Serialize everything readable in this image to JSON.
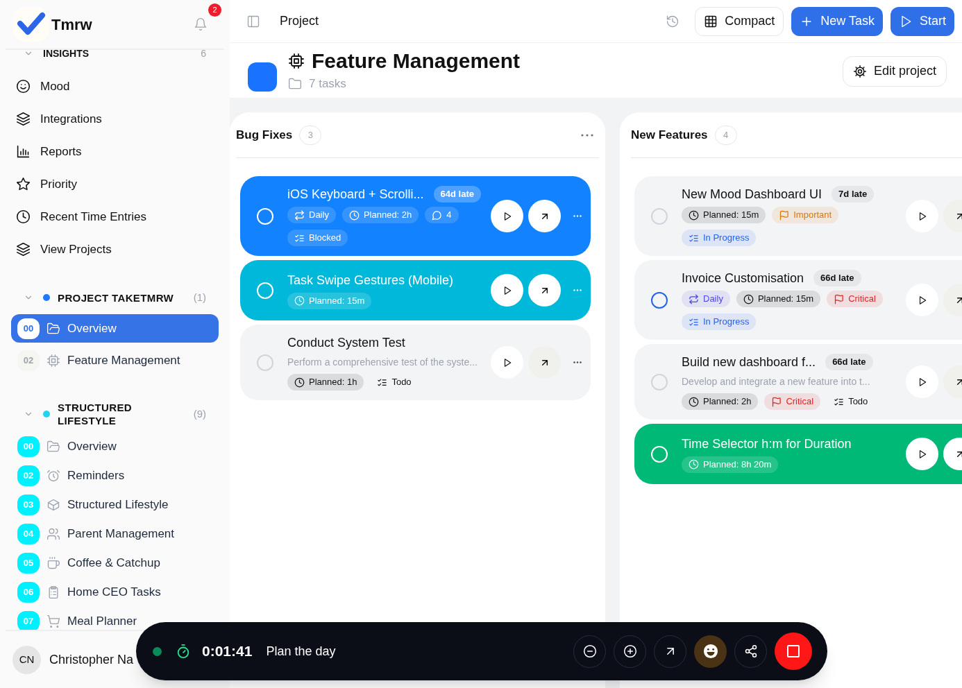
{
  "app": {
    "name": "Tmrw",
    "notifications": "2"
  },
  "sidebar": {
    "insights": {
      "title": "INSIGHTS",
      "count": "6",
      "expanded": true,
      "items": [
        {
          "kind": "smile",
          "label": "Mood"
        },
        {
          "kind": "layers",
          "label": "Integrations"
        },
        {
          "kind": "chart",
          "label": "Reports"
        },
        {
          "kind": "star",
          "label": "Priority"
        },
        {
          "kind": "clock",
          "label": "Recent Time Entries"
        },
        {
          "kind": "layers",
          "label": "View Projects"
        }
      ]
    },
    "projects": [
      {
        "title": "PROJECT TAKETMRW",
        "count": "(1)",
        "color": "#1e7bff",
        "expanded": true,
        "badges_filled": false,
        "items": [
          {
            "number": "00",
            "kind": "folder",
            "label": "Overview",
            "selected": true
          },
          {
            "number": "02",
            "kind": "chip",
            "label": "Feature Management",
            "selected": false
          }
        ]
      },
      {
        "title": "STRUCTURED LIFESTYLE",
        "count": "(9)",
        "color": "#22d3ee",
        "expanded": true,
        "badges_filled": true,
        "items": [
          {
            "number": "00",
            "kind": "folder",
            "label": "Overview",
            "selected": false
          },
          {
            "number": "02",
            "kind": "alarm",
            "label": "Reminders",
            "selected": false
          },
          {
            "number": "03",
            "kind": "cube",
            "label": "Structured Lifestyle",
            "selected": false
          },
          {
            "number": "04",
            "kind": "users",
            "label": "Parent Management",
            "selected": false
          },
          {
            "number": "05",
            "kind": "coffee",
            "label": "Coffee & Catchup",
            "selected": false
          },
          {
            "number": "06",
            "kind": "clipboard",
            "label": "Home CEO Tasks",
            "selected": false
          },
          {
            "number": "07",
            "kind": "cart",
            "label": "Meal Planner",
            "selected": false
          }
        ]
      }
    ],
    "user": {
      "initials": "CN",
      "name": "Christopher Na"
    }
  },
  "toolbar": {
    "title": "Project",
    "buttons": [
      {
        "kind": "compact",
        "label": "Compact"
      },
      {
        "kind": "new",
        "label": "New Task"
      },
      {
        "kind": "start",
        "label": "Start"
      }
    ]
  },
  "project": {
    "title": "Feature Management",
    "task_count": "7 tasks",
    "edit_label": "Edit project"
  },
  "columns": [
    {
      "title": "Bug Fixes",
      "count": "3",
      "has_menu": true,
      "tasks": [
        {
          "kind": "blue",
          "title": "iOS Keyboard + Scrolli...",
          "late": "64d late",
          "color": "#ffffff",
          "tags": [
            {
              "kind": "repeat",
              "text": "Daily"
            },
            {
              "kind": "planned",
              "text": "Planned: 2h"
            },
            {
              "kind": "comments",
              "text": "4"
            },
            {
              "kind": "status",
              "text": "Blocked"
            }
          ]
        },
        {
          "kind": "cyan",
          "title": "Task Swipe Gestures (Mobile)",
          "color": "#ffffff",
          "tags": [
            {
              "kind": "planned",
              "text": "Planned: 15m"
            }
          ]
        },
        {
          "kind": "plain",
          "title": "Conduct System Test",
          "description": "Perform a comprehensive test of the syste...",
          "color": "#d1d5db",
          "tags": [
            {
              "kind": "planned",
              "text": "Planned: 1h",
              "color": "#111111"
            },
            {
              "kind": "status",
              "text": "Todo"
            }
          ]
        }
      ]
    },
    {
      "title": "New Features",
      "count": "4",
      "has_menu": false,
      "tasks": [
        {
          "kind": "plain",
          "title": "New Mood Dashboard UI",
          "late": "7d late",
          "color": "#d1d5db",
          "tags": [
            {
              "kind": "planned",
              "text": "Planned: 15m",
              "color": "#111111"
            },
            {
              "kind": "priority",
              "text": "Important",
              "color": "#d97706"
            },
            {
              "kind": "status",
              "text": "In Progress",
              "color": "#2563eb"
            }
          ]
        },
        {
          "kind": "plain",
          "title": "Invoice Customisation",
          "late": "66d late",
          "color": "#2563eb",
          "tags": [
            {
              "kind": "repeat",
              "text": "Daily",
              "color": "#4f46e5"
            },
            {
              "kind": "planned",
              "text": "Planned: 15m",
              "color": "#111111"
            },
            {
              "kind": "priority",
              "text": "Critical",
              "color": "#dc2626"
            },
            {
              "kind": "status",
              "text": "In Progress",
              "color": "#2563eb"
            }
          ]
        },
        {
          "kind": "plain",
          "title": "Build new dashboard f...",
          "late": "66d late",
          "description": "Develop and integrate a new feature into t...",
          "color": "#d1d5db",
          "tags": [
            {
              "kind": "planned",
              "text": "Planned: 2h",
              "color": "#111111"
            },
            {
              "kind": "priority",
              "text": "Critical",
              "color": "#dc2626"
            },
            {
              "kind": "status",
              "text": "Todo"
            }
          ]
        },
        {
          "kind": "green",
          "title": "Time Selector h:m for Duration",
          "color": "#ffffff",
          "tags": [
            {
              "kind": "planned",
              "text": "Planned: 8h 20m"
            }
          ]
        }
      ]
    }
  ],
  "timer": {
    "running": true,
    "elapsed": "0:01:41",
    "task": "Plan the day"
  }
}
